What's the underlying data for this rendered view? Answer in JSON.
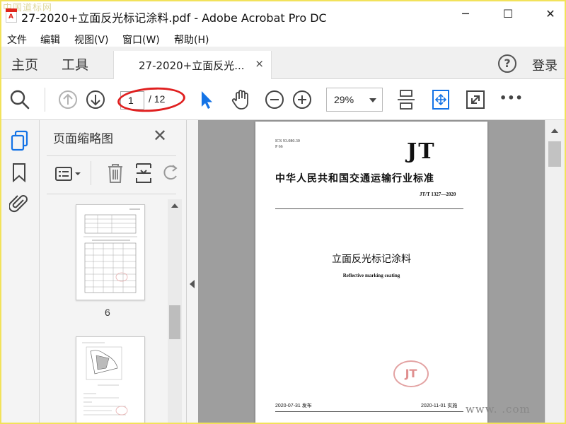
{
  "window": {
    "title": "27-2020+立面反光标记涂料.pdf - Adobe Acrobat Pro DC",
    "watermark_top": "中国道标网",
    "watermark_bottom": "www.        .com",
    "controls": {
      "minimize": "─",
      "maximize": "☐",
      "close": "✕"
    }
  },
  "menubar": {
    "items": [
      {
        "label": "文件"
      },
      {
        "label": "编辑"
      },
      {
        "label": "视图(V)"
      },
      {
        "label": "窗口(W)"
      },
      {
        "label": "帮助(H)"
      }
    ]
  },
  "tabs": {
    "home": "主页",
    "tools": "工具",
    "document": "27-2020+立面反光...",
    "close": "×",
    "help": "?",
    "login": "登录"
  },
  "toolbar": {
    "current_page": "1",
    "total_pages": "/ 12",
    "zoom": "29%",
    "more": "•••"
  },
  "thumbnail_panel": {
    "title": "页面缩略图",
    "close": "✕",
    "page_label": "6"
  },
  "document": {
    "ics_line1": "ICS 93.080.30",
    "ics_line2": "P 66",
    "logo": "JT",
    "standard_name": "中华人民共和国交通运输行业标准",
    "standard_number": "JT/T 1327—2020",
    "title": "立面反光标记涂料",
    "subtitle": "Reflective marking coating",
    "seal": "JT",
    "issue_date": "2020-07-31 发布",
    "implement_date": "2020-11-01 实施"
  },
  "colors": {
    "accent_blue": "#1473e6",
    "annotation_red": "#e02020",
    "frame_yellow": "#f2e25a",
    "doc_background": "#9e9e9e"
  }
}
